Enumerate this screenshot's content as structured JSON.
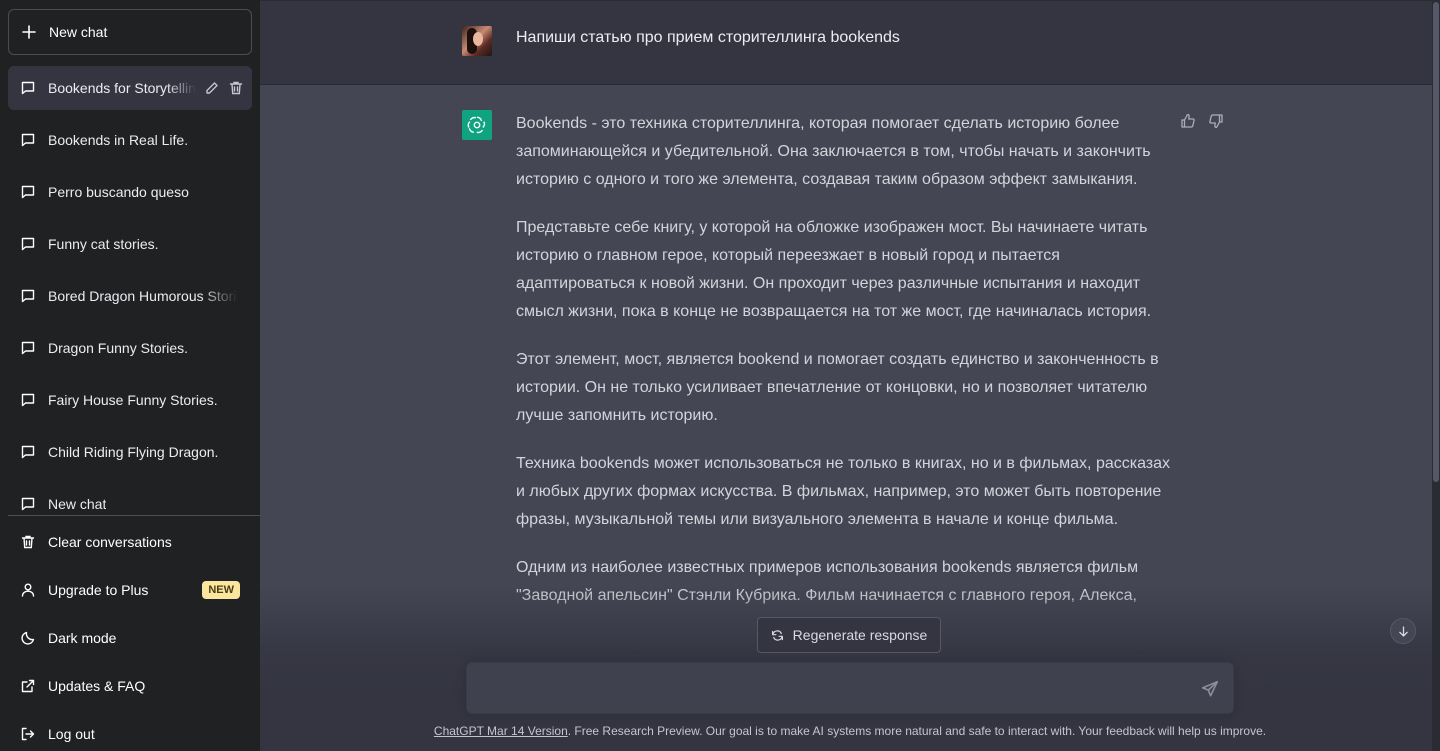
{
  "sidebar": {
    "new_chat_label": "New chat",
    "history": [
      {
        "label": "Bookends for Storytelling",
        "active": true
      },
      {
        "label": "Bookends in Real Life."
      },
      {
        "label": "Perro buscando queso"
      },
      {
        "label": "Funny cat stories."
      },
      {
        "label": "Bored Dragon Humorous Stories"
      },
      {
        "label": "Dragon Funny Stories."
      },
      {
        "label": "Fairy House Funny Stories."
      },
      {
        "label": "Child Riding Flying Dragon."
      },
      {
        "label": "New chat"
      }
    ],
    "menu": {
      "clear": "Clear conversations",
      "upgrade": "Upgrade to Plus",
      "upgrade_badge": "NEW",
      "dark_mode": "Dark mode",
      "updates": "Updates & FAQ",
      "logout": "Log out"
    }
  },
  "conversation": {
    "user_message": "Напиши статью про прием сторителлинга bookends",
    "assistant_paragraphs": [
      "Bookends - это техника сторителлинга, которая помогает сделать историю более запоминающейся и убедительной. Она заключается в том, чтобы начать и закончить историю с одного и того же элемента, создавая таким образом эффект замыкания.",
      "Представьте себе книгу, у которой на обложке изображен мост. Вы начинаете читать историю о главном герое, который переезжает в новый город и пытается адаптироваться к новой жизни. Он проходит через различные испытания и находит смысл жизни, пока в конце не возвращается на тот же мост, где начиналась история.",
      "Этот элемент, мост, является bookend и помогает создать единство и законченность в истории. Он не только усиливает впечатление от концовки, но и позволяет читателю лучше запомнить историю.",
      "Техника bookends может использоваться не только в книгах, но и в фильмах, рассказах и любых других формах искусства. В фильмах, например, это может быть повторение фразы, музыкальной темы или визуального элемента в начале и конце фильма.",
      "Одним из наиболее известных примеров использования bookends является фильм \"Заводной апельсин\" Стэнли Кубрика. Фильм начинается с главного героя, Алекса,"
    ]
  },
  "composer": {
    "regenerate_label": "Regenerate response",
    "placeholder": ""
  },
  "footer": {
    "version_link": "ChatGPT Mar 14 Version",
    "text": ". Free Research Preview. Our goal is to make AI systems more natural and safe to interact with. Your feedback will help us improve."
  },
  "colors": {
    "sidebar_bg": "#202123",
    "main_bg": "#343541",
    "assistant_bg": "#444654",
    "brand_green": "#10a37f",
    "badge_yellow": "#fae69e"
  }
}
